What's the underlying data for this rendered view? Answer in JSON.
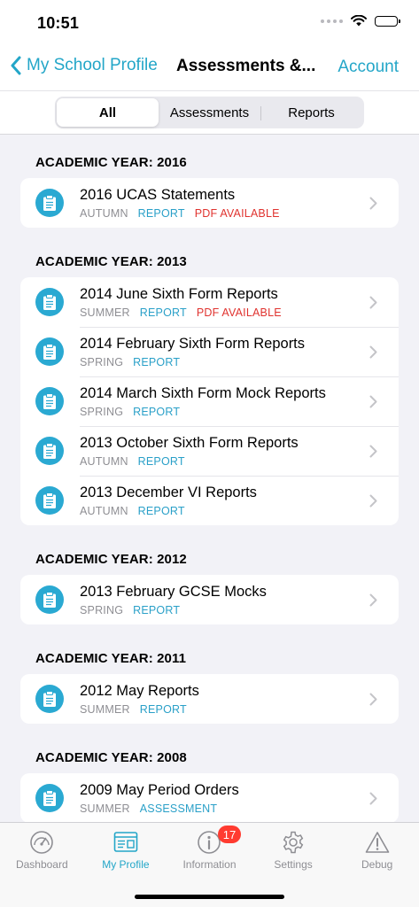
{
  "status": {
    "time": "10:51"
  },
  "nav": {
    "back_label": "My School Profile",
    "title": "Assessments &...",
    "account_label": "Account"
  },
  "segments": [
    "All",
    "Assessments",
    "Reports"
  ],
  "sections": [
    {
      "header": "ACADEMIC YEAR: 2016",
      "items": [
        {
          "title": "2016 UCAS Statements",
          "season": "AUTUMN",
          "type": "REPORT",
          "pdf": "PDF AVAILABLE"
        }
      ]
    },
    {
      "header": "ACADEMIC YEAR: 2013",
      "items": [
        {
          "title": "2014 June Sixth Form Reports",
          "season": "SUMMER",
          "type": "REPORT",
          "pdf": "PDF AVAILABLE"
        },
        {
          "title": "2014 February Sixth Form Reports",
          "season": "SPRING",
          "type": "REPORT"
        },
        {
          "title": "2014 March Sixth Form Mock Reports",
          "season": "SPRING",
          "type": "REPORT"
        },
        {
          "title": "2013 October Sixth Form Reports",
          "season": "AUTUMN",
          "type": "REPORT"
        },
        {
          "title": "2013 December VI Reports",
          "season": "AUTUMN",
          "type": "REPORT"
        }
      ]
    },
    {
      "header": "ACADEMIC YEAR: 2012",
      "items": [
        {
          "title": "2013 February GCSE Mocks",
          "season": "SPRING",
          "type": "REPORT"
        }
      ]
    },
    {
      "header": "ACADEMIC YEAR: 2011",
      "items": [
        {
          "title": "2012 May Reports",
          "season": "SUMMER",
          "type": "REPORT"
        }
      ]
    },
    {
      "header": "ACADEMIC YEAR: 2008",
      "items": [
        {
          "title": "2009 May Period Orders",
          "season": "SUMMER",
          "type": "ASSESSMENT"
        }
      ]
    }
  ],
  "tabs": [
    {
      "label": "Dashboard",
      "icon": "dashboard-icon"
    },
    {
      "label": "My Profile",
      "icon": "profile-icon"
    },
    {
      "label": "Information",
      "icon": "info-icon"
    },
    {
      "label": "Settings",
      "icon": "gear-icon"
    },
    {
      "label": "Debug",
      "icon": "warning-icon"
    }
  ],
  "info_badge": "17",
  "colors": {
    "accent": "#23a6c8",
    "pdf": "#e0332f",
    "icon_bg": "#2aa9d2"
  }
}
